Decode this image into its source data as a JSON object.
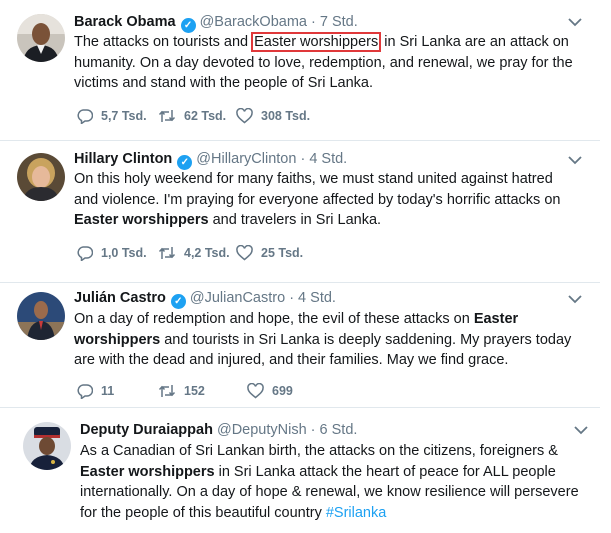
{
  "tweets": [
    {
      "name": "Barack Obama",
      "handle": "@BarackObama",
      "time": "· 7 Std.",
      "text_parts": {
        "a": "The attacks on tourists and ",
        "highlight": "Easter worshippers",
        "b": " in Sri Lanka are an attack on humanity. On a day devoted to love, redemption, and renewal, we pray for the victims and stand with the people of Sri Lanka."
      },
      "replies": "5,7 Tsd.",
      "retweets": "62 Tsd.",
      "likes": "308 Tsd."
    },
    {
      "name": "Hillary Clinton",
      "handle": "@HillaryClinton",
      "time": "· 4 Std.",
      "text_parts": {
        "a": "On this holy weekend for many faiths, we must stand united against hatred and violence. I'm praying for everyone affected by today's horrific attacks on ",
        "bold": "Easter worshippers",
        "b": " and travelers in Sri Lanka."
      },
      "replies": "1,0 Tsd.",
      "retweets": "4,2 Tsd.",
      "likes": "25 Tsd."
    },
    {
      "name": "Julián Castro",
      "handle": "@JulianCastro",
      "time": "· 4 Std.",
      "text_parts": {
        "a": "On a day of redemption and hope, the evil of these attacks on ",
        "bold": "Easter worshippers",
        "b": " and tourists in Sri Lanka is deeply saddening. My prayers today are with the dead and injured, and their families. May we find grace."
      },
      "replies": "11",
      "retweets": "152",
      "likes": "699"
    },
    {
      "name": "Deputy Duraiappah",
      "handle": "@DeputyNish",
      "time": "· 6 Std.",
      "text_parts": {
        "a": "As a Canadian of Sri Lankan birth, the attacks on the citizens, foreigners & ",
        "bold": "Easter worshippers",
        "b": " in Sri Lanka attack the heart of peace for ALL people internationally. On a day of hope & renewal, we know resilience will persevere for the people of this beautiful country ",
        "hashtag": "#Srilanka"
      }
    }
  ],
  "colors": {
    "verified": "#1da1f2",
    "highlight_box": "#e0383a",
    "muted": "#657786",
    "hashtag": "#1da1f2"
  },
  "icons": [
    "verified-badge-icon",
    "chevron-down-icon",
    "reply-icon",
    "retweet-icon",
    "like-icon"
  ]
}
